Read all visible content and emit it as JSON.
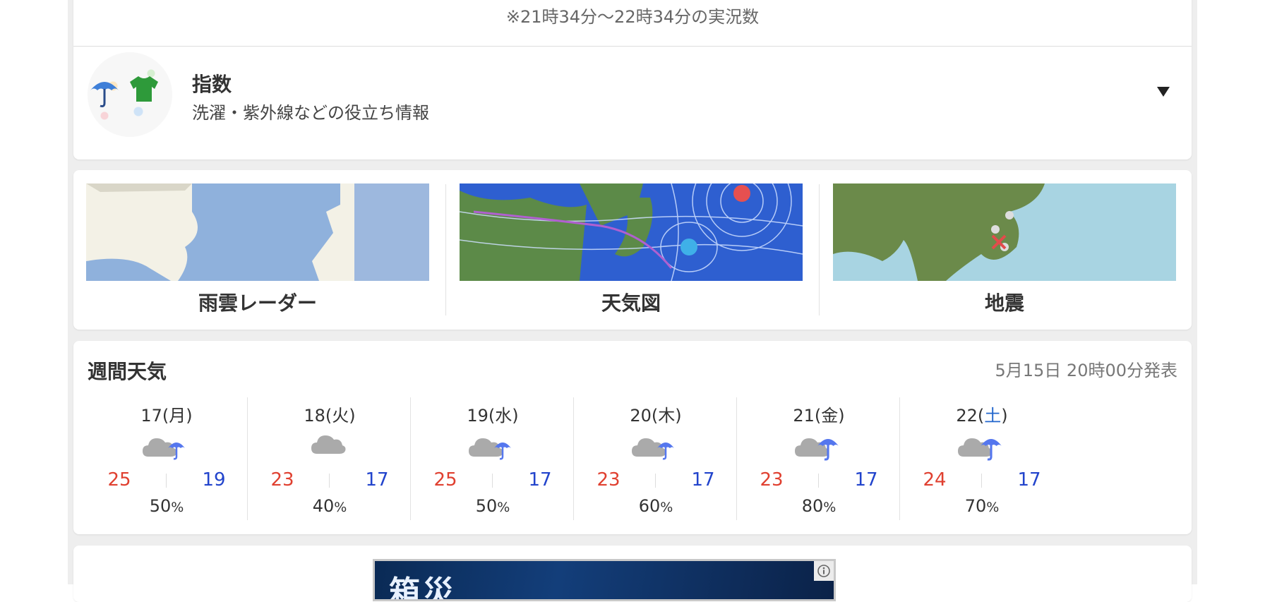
{
  "observation": {
    "note": "※21時34分〜22時34分の実況数"
  },
  "index": {
    "title": "指数",
    "subtitle": "洗濯・紫外線などの役立ち情報",
    "image_icons": [
      "umbrella-icon",
      "shirt-icon"
    ],
    "toggle_icon": "triangle-down-icon"
  },
  "maps": [
    {
      "label": "雨雲レーダー",
      "image": "rain-radar-map-thumbnail"
    },
    {
      "label": "天気図",
      "image": "weather-chart-thumbnail"
    },
    {
      "label": "地震",
      "image": "earthquake-map-thumbnail"
    }
  ],
  "weekly": {
    "title": "週間天気",
    "issued": "5月15日 20時00分発表",
    "days": [
      {
        "date_num": "17",
        "weekday": "月",
        "icon": "cloud-rain-icon",
        "high": "25",
        "low": "19",
        "pop": "50",
        "pop_unit": "%",
        "saturday": false
      },
      {
        "date_num": "18",
        "weekday": "火",
        "icon": "cloud-icon",
        "high": "23",
        "low": "17",
        "pop": "40",
        "pop_unit": "%",
        "saturday": false
      },
      {
        "date_num": "19",
        "weekday": "水",
        "icon": "cloud-rain-icon",
        "high": "25",
        "low": "17",
        "pop": "50",
        "pop_unit": "%",
        "saturday": false
      },
      {
        "date_num": "20",
        "weekday": "木",
        "icon": "cloud-rain-icon",
        "high": "23",
        "low": "17",
        "pop": "60",
        "pop_unit": "%",
        "saturday": false
      },
      {
        "date_num": "21",
        "weekday": "金",
        "icon": "cloud-heavy-rain-icon",
        "high": "23",
        "low": "17",
        "pop": "80",
        "pop_unit": "%",
        "saturday": false
      },
      {
        "date_num": "22",
        "weekday": "土",
        "icon": "cloud-heavy-rain-icon",
        "high": "24",
        "low": "17",
        "pop": "70",
        "pop_unit": "%",
        "saturday": true
      }
    ]
  },
  "ad": {
    "text": "箱災",
    "info_icon": "ad-info-icon"
  },
  "colors": {
    "high_temp": "#e04030",
    "low_temp": "#2244cc",
    "umbrella": "#5577ee",
    "cloud": "#aaaaaa",
    "saturday": "#2266cc"
  }
}
